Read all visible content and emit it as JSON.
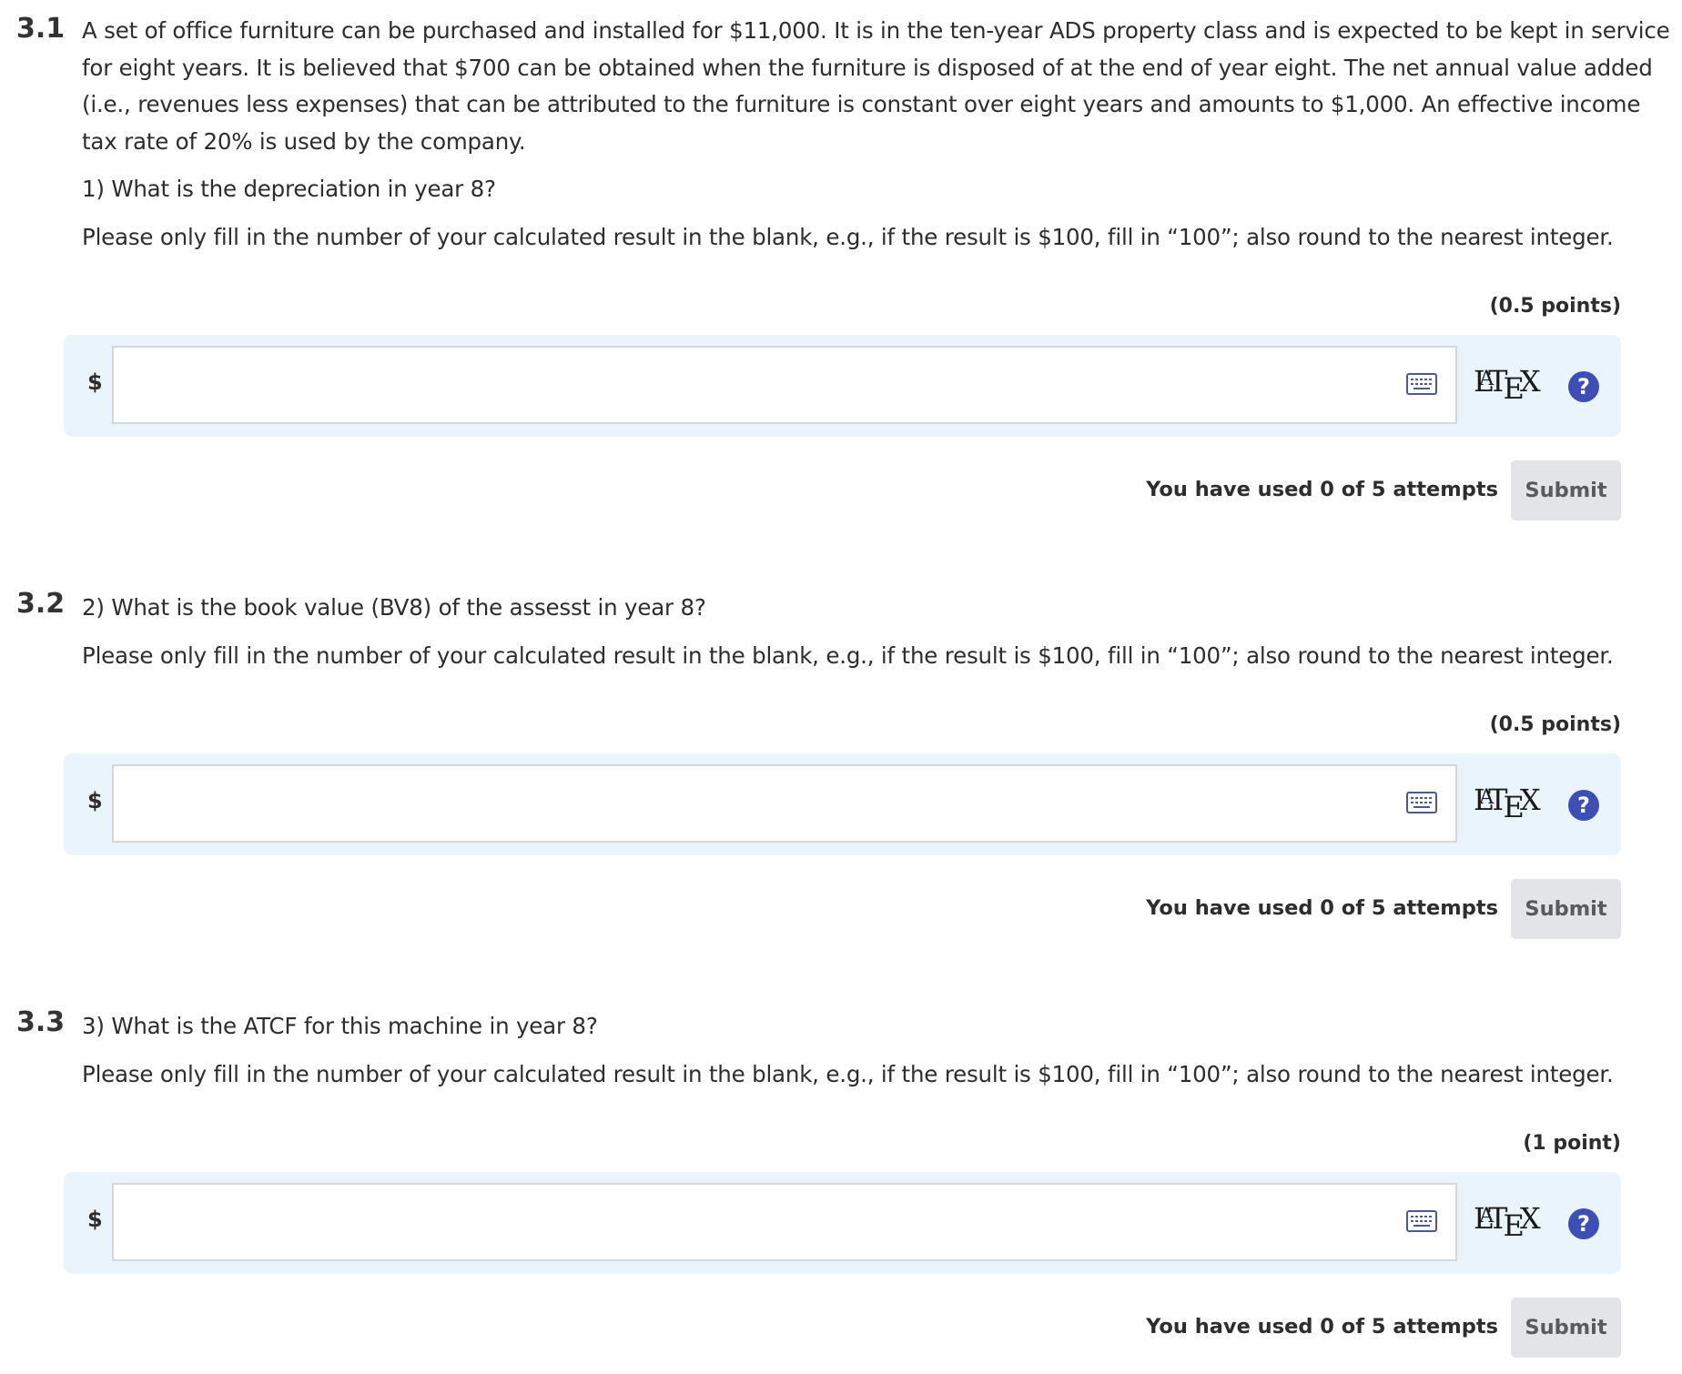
{
  "questions": [
    {
      "number": "3.1",
      "paragraphs": [
        "A set of office furniture can be purchased and installed for $11,000. It is in the ten-year ADS property class and is expected to be kept in service for eight years. It is believed that $700 can be obtained when the furniture is disposed of at the end of year eight. The net annual value added (i.e., revenues less expenses) that can be attributed to the furniture is constant over eight years and amounts to $1,000. An effective income tax rate of 20% is used by the company.",
        "1) What is the depreciation in year 8?",
        "Please only fill in the number of your calculated result in the blank, e.g., if the result is $100, fill in “100”; also round to the nearest integer."
      ],
      "points": "(0.5 points)",
      "prefix": "$",
      "input_value": "",
      "attempts_text": "You have used 0 of 5 attempts",
      "submit_label": "Submit"
    },
    {
      "number": "3.2",
      "paragraphs": [
        "2) What is the book value (BV8) of the assesst in year 8?",
        "Please only fill in the number of your calculated result in the blank, e.g., if the result is $100, fill in “100”; also round to the nearest integer."
      ],
      "points": "(0.5 points)",
      "prefix": "$",
      "input_value": "",
      "attempts_text": "You have used 0 of 5 attempts",
      "submit_label": "Submit"
    },
    {
      "number": "3.3",
      "paragraphs": [
        "3) What is the ATCF for this machine in year 8?",
        "Please only fill in the number of your calculated result in the blank, e.g., if the result is $100, fill in “100”; also round to the nearest integer."
      ],
      "points": "(1 point)",
      "prefix": "$",
      "input_value": "",
      "attempts_text": "You have used 0 of 5 attempts",
      "submit_label": "Submit"
    }
  ],
  "latex_label": "LaTeX",
  "help_icon_glyph": "?",
  "icons": {
    "keyboard": "keyboard-icon",
    "help": "help-icon"
  },
  "colors": {
    "answer_box_bg": "#e9f4fd",
    "help_icon_bg": "#3d4fb5",
    "submit_bg": "#e2e4e7"
  }
}
